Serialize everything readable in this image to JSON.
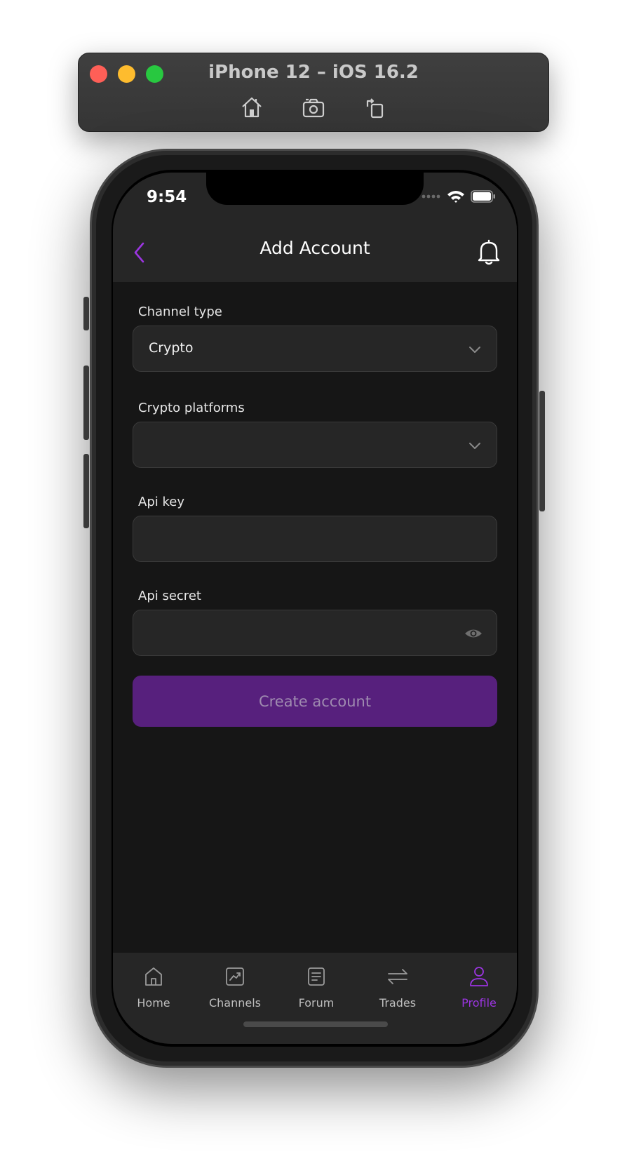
{
  "simulator": {
    "title": "iPhone 12 – iOS 16.2",
    "tools": [
      "home-icon",
      "screenshot-icon",
      "rotate-icon"
    ]
  },
  "status_bar": {
    "time": "9:54"
  },
  "header": {
    "title": "Add Account"
  },
  "form": {
    "channel_type": {
      "label": "Channel type",
      "value": "Crypto"
    },
    "crypto_platforms": {
      "label": "Crypto platforms",
      "value": ""
    },
    "api_key": {
      "label": "Api key",
      "value": ""
    },
    "api_secret": {
      "label": "Api secret",
      "value": ""
    },
    "submit_label": "Create account"
  },
  "tabbar": {
    "items": [
      {
        "label": "Home",
        "icon": "home-icon"
      },
      {
        "label": "Channels",
        "icon": "chart-icon"
      },
      {
        "label": "Forum",
        "icon": "document-icon"
      },
      {
        "label": "Trades",
        "icon": "swap-icon"
      },
      {
        "label": "Profile",
        "icon": "user-icon",
        "active": true
      }
    ]
  },
  "colors": {
    "accent": "#9b35e0",
    "button_bg": "#57207d",
    "screen_bg": "#161616",
    "panel_bg": "#262626"
  }
}
